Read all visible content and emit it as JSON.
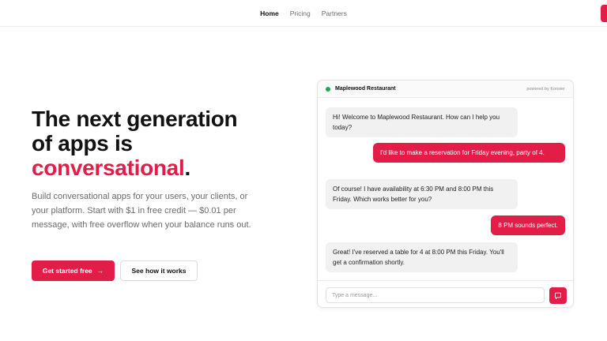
{
  "nav": {
    "links": [
      {
        "label": "Home",
        "active": true
      },
      {
        "label": "Pricing",
        "active": false
      },
      {
        "label": "Partners",
        "active": false
      }
    ]
  },
  "hero": {
    "title_line1": "The next generation",
    "title_line2": "of apps is",
    "title_accent": "conversational",
    "title_period": ".",
    "subtitle": "Build conversational apps for your users, your clients, or your platform. Start with $1 in free credit — $0.01 per message, with free overflow when your balance runs out.",
    "primary_cta": "Get started free",
    "primary_cta_arrow": "→",
    "secondary_cta": "See how it works"
  },
  "chat": {
    "business_name": "Maplewood Restaurant",
    "powered_by": "powered by Konsier",
    "messages": [
      {
        "role": "bot",
        "text": "Hi! Welcome to Maplewood Restaurant. How can I help you today?"
      },
      {
        "role": "user",
        "text": "I'd like to make a reservation for Friday evening, party of 4."
      },
      {
        "role": "bot",
        "text": "Of course! I have availability at 6:30 PM and 8:00 PM this Friday. Which works better for you?"
      },
      {
        "role": "user",
        "text": "8 PM sounds perfect."
      },
      {
        "role": "bot",
        "text": "Great! I've reserved a table for 4 at 8:00 PM this Friday. You'll get a confirmation shortly."
      }
    ],
    "input_placeholder": "Type a message..."
  },
  "colors": {
    "accent": "#e11d48",
    "status_online": "#22a55a"
  },
  "icons": {
    "send": "send-message-icon",
    "status": "online-status-dot"
  }
}
